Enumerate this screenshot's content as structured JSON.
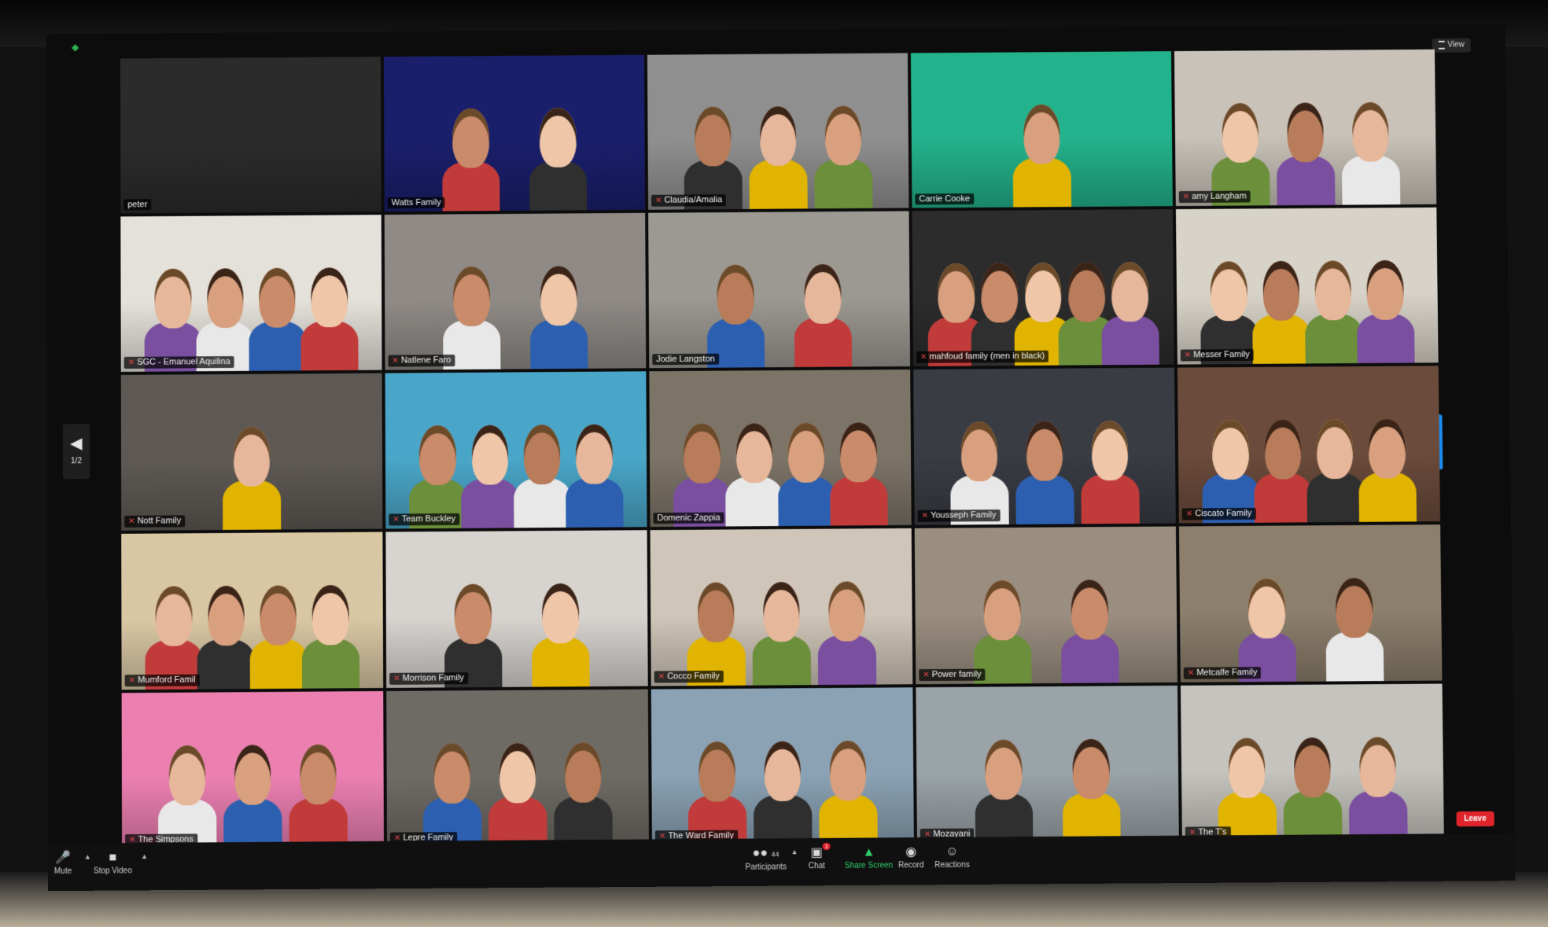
{
  "window": {
    "view_label": "View",
    "page_indicator": "1/2"
  },
  "participants": [
    {
      "name": "peter",
      "muted": false,
      "bg": "#2b2b2b",
      "people": 0
    },
    {
      "name": "Watts Family",
      "muted": false,
      "bg": "#1a1f6b",
      "people": 2,
      "active": true
    },
    {
      "name": "Claudia/Amalia",
      "muted": true,
      "bg": "#8f8f8f",
      "people": 3
    },
    {
      "name": "Carrie Cooke",
      "muted": false,
      "bg": "#23b38c",
      "people": 1
    },
    {
      "name": "amy Langham",
      "muted": true,
      "bg": "#c8c2b8",
      "people": 3
    },
    {
      "name": "SGC - Emanuel Aquilina",
      "muted": true,
      "bg": "#e4e1da",
      "people": 4
    },
    {
      "name": "Natlene Faro",
      "muted": true,
      "bg": "#8f8a86",
      "people": 2
    },
    {
      "name": "Jodie Langston",
      "muted": false,
      "bg": "#9c9992",
      "people": 2
    },
    {
      "name": "mahfoud family (men in black)",
      "muted": true,
      "bg": "#2c2c2c",
      "people": 5
    },
    {
      "name": "Messer Family",
      "muted": true,
      "bg": "#d8d3c8",
      "people": 4
    },
    {
      "name": "Nott Family",
      "muted": true,
      "bg": "#5e5954",
      "people": 1
    },
    {
      "name": "Team Buckley",
      "muted": true,
      "bg": "#4aa6c8",
      "people": 4
    },
    {
      "name": "Domenic Zappia",
      "muted": false,
      "bg": "#7d7468",
      "people": 4
    },
    {
      "name": "Yousseph Family",
      "muted": true,
      "bg": "#3a3c44",
      "people": 3
    },
    {
      "name": "Ciscato Family",
      "muted": true,
      "bg": "#6b4b3b",
      "people": 4
    },
    {
      "name": "Mumford Famil",
      "muted": true,
      "bg": "#d9c7a4",
      "people": 4
    },
    {
      "name": "Morrison Family",
      "muted": true,
      "bg": "#d7d3cf",
      "people": 2
    },
    {
      "name": "Cocco Family",
      "muted": true,
      "bg": "#cfc5b8",
      "people": 3
    },
    {
      "name": "Power family",
      "muted": true,
      "bg": "#9a8e80",
      "people": 2
    },
    {
      "name": "Metcalfe Family",
      "muted": true,
      "bg": "#8c7f6c",
      "people": 2
    },
    {
      "name": "The Simpsons",
      "muted": true,
      "bg": "#ea7fb0",
      "people": 3
    },
    {
      "name": "Lepre Family",
      "muted": true,
      "bg": "#6e6a64",
      "people": 3
    },
    {
      "name": "The Ward Family",
      "muted": true,
      "bg": "#8aa2b4",
      "people": 3
    },
    {
      "name": "Mozayani",
      "muted": true,
      "bg": "#9aa3a8",
      "people": 2
    },
    {
      "name": "The T's",
      "muted": true,
      "bg": "#c5c3bd",
      "people": 3
    }
  ],
  "toolbar": {
    "mute_label": "Mute",
    "stop_video_label": "Stop Video",
    "participants_label": "Participants",
    "participants_count": "44",
    "chat_label": "Chat",
    "chat_badge": "1",
    "share_screen_label": "Share Screen",
    "record_label": "Record",
    "reactions_label": "Reactions",
    "leave_label": "Leave"
  },
  "colors": {
    "accent_blue": "#1a8cf0",
    "active_speaker": "#f3dd3b",
    "leave_red": "#e0242b",
    "share_green": "#2fd06b"
  },
  "icons": {
    "mute": "microphone-icon",
    "video": "camera-icon",
    "participants": "people-icon",
    "chat": "chat-bubble-icon",
    "share": "share-screen-icon",
    "record": "record-icon",
    "reactions": "emoji-icon"
  }
}
